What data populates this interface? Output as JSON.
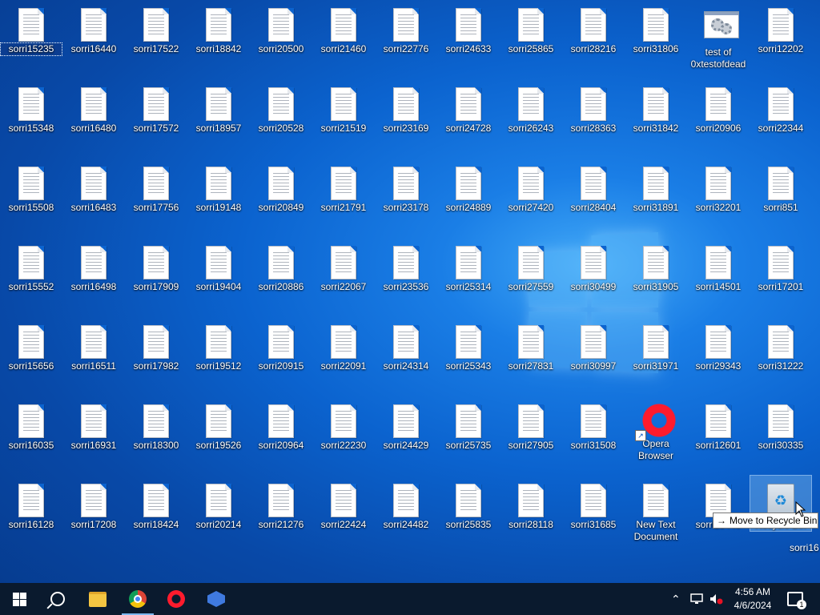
{
  "desktop": {
    "rows": [
      [
        "sorri15235",
        "sorri16440",
        "sorri17522",
        "sorri18842",
        "sorri20500",
        "sorri21460",
        "sorri22776",
        "sorri24633",
        "sorri25865",
        "sorri28216",
        "sorri31806",
        "test of 0xtestofdead",
        "sorri12202"
      ],
      [
        "sorri15348",
        "sorri16480",
        "sorri17572",
        "sorri18957",
        "sorri20528",
        "sorri21519",
        "sorri23169",
        "sorri24728",
        "sorri26243",
        "sorri28363",
        "sorri31842",
        "sorri20906",
        "sorri22344"
      ],
      [
        "sorri15508",
        "sorri16483",
        "sorri17756",
        "sorri19148",
        "sorri20849",
        "sorri21791",
        "sorri23178",
        "sorri24889",
        "sorri27420",
        "sorri28404",
        "sorri31891",
        "sorri32201",
        "sorri851"
      ],
      [
        "sorri15552",
        "sorri16498",
        "sorri17909",
        "sorri19404",
        "sorri20886",
        "sorri22067",
        "sorri23536",
        "sorri25314",
        "sorri27559",
        "sorri30499",
        "sorri31905",
        "sorri14501",
        "sorri17201"
      ],
      [
        "sorri15656",
        "sorri16511",
        "sorri17982",
        "sorri19512",
        "sorri20915",
        "sorri22091",
        "sorri24314",
        "sorri25343",
        "sorri27831",
        "sorri30997",
        "sorri31971",
        "sorri29343",
        "sorri31222"
      ],
      [
        "sorri16035",
        "sorri16931",
        "sorri18300",
        "sorri19526",
        "sorri20964",
        "sorri22230",
        "sorri24429",
        "sorri25735",
        "sorri27905",
        "sorri31508",
        "Opera Browser",
        "sorri12601",
        "sorri30335"
      ],
      [
        "sorri16128",
        "sorri17208",
        "sorri18424",
        "sorri20214",
        "sorri21276",
        "sorri22424",
        "sorri24482",
        "sorri25835",
        "sorri28118",
        "sorri31685",
        "New Text Document",
        "sorri28440",
        "Recycle Bin"
      ]
    ],
    "special_icons": {
      "0,11": "gear-window-icon",
      "5,10": "opera-icon",
      "6,12": "recycle-bin-icon"
    },
    "selected": "0,0"
  },
  "drag": {
    "tooltip_label": "Move to Recycle Bin",
    "ghost_label": "sorri16"
  },
  "taskbar": {
    "pinned": [
      {
        "name": "start-button",
        "icon": "windows-icon"
      },
      {
        "name": "search-button",
        "icon": "search-icon"
      },
      {
        "name": "file-explorer-button",
        "icon": "folder-icon"
      },
      {
        "name": "chrome-button",
        "icon": "chrome-icon"
      },
      {
        "name": "opera-button",
        "icon": "opera-icon"
      },
      {
        "name": "app-button",
        "icon": "app-icon"
      }
    ],
    "clock_time": "4:56 AM",
    "clock_date": "4/6/2024",
    "notification_count": "1"
  },
  "colors": {
    "accent": "#0b63cf",
    "taskbar": "#0a1a2e",
    "opera_red": "#ff1b2d"
  }
}
